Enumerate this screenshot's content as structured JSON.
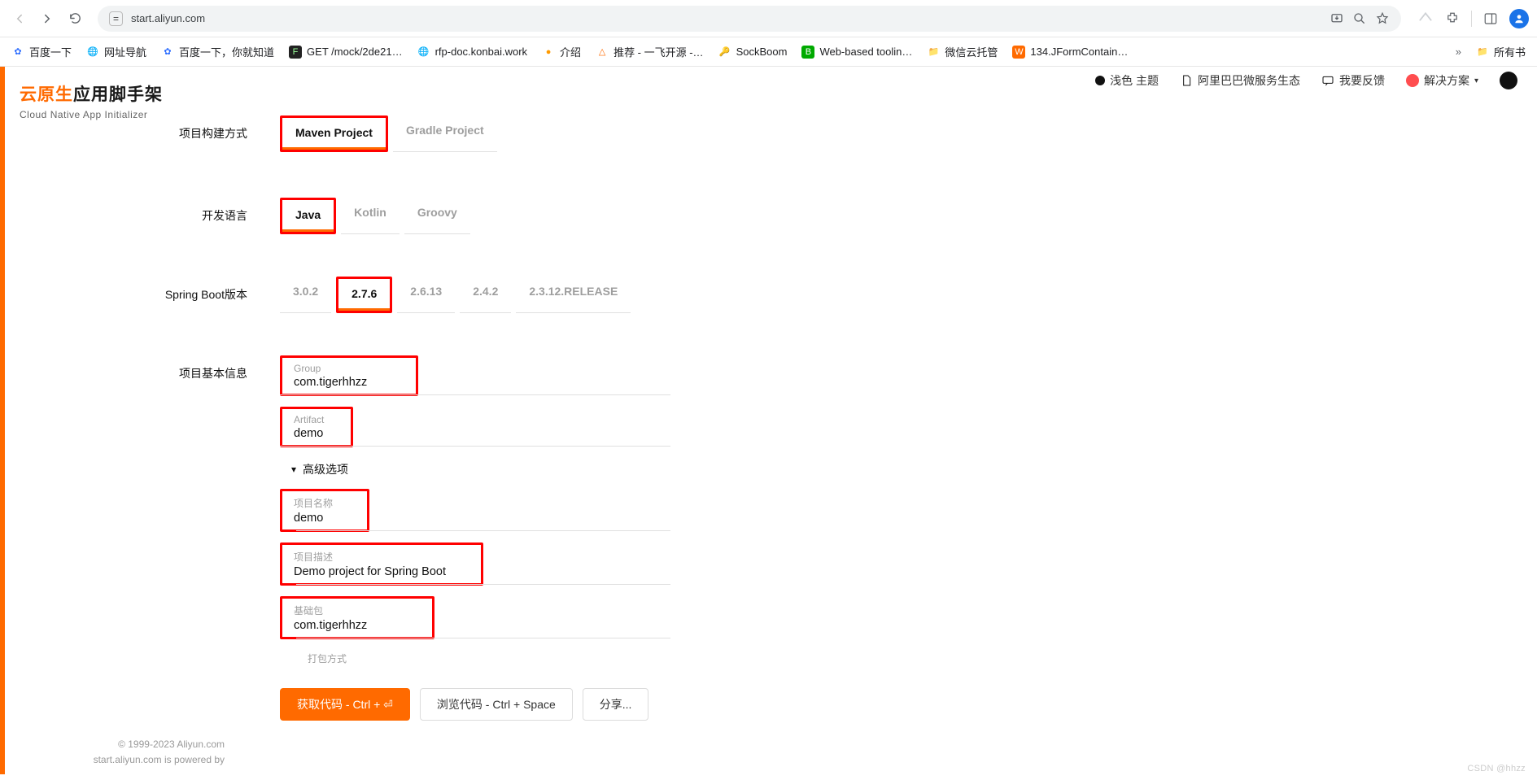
{
  "browser": {
    "url": "start.aliyun.com",
    "bookmarks": [
      {
        "icon": "paw-blue",
        "label": "百度一下"
      },
      {
        "icon": "globe",
        "label": "网址导航"
      },
      {
        "icon": "paw-blue",
        "label": "百度一下，你就知道"
      },
      {
        "icon": "box-dark",
        "label": "GET /mock/2de21…"
      },
      {
        "icon": "globe",
        "label": "rfp-doc.konbai.work"
      },
      {
        "icon": "leaf",
        "label": "介绍"
      },
      {
        "icon": "tri",
        "label": "推荐 - 一飞开源 -…"
      },
      {
        "icon": "key",
        "label": "SockBoom"
      },
      {
        "icon": "b-green",
        "label": "Web-based toolin…"
      },
      {
        "icon": "folder",
        "label": "微信云托管"
      },
      {
        "icon": "box-orange",
        "label": "134.JFormContain…"
      }
    ],
    "more_label": "所有书"
  },
  "header": {
    "brand_accent": "云原生",
    "brand_rest": "应用脚手架",
    "brand_sub": "Cloud Native App Initializer",
    "nav": {
      "theme": "浅色 主题",
      "eco": "阿里巴巴微服务生态",
      "feedback": "我要反馈",
      "solution": "解决方案"
    }
  },
  "form": {
    "build": {
      "label": "项目构建方式",
      "options": [
        "Maven Project",
        "Gradle Project"
      ],
      "active": 0
    },
    "language": {
      "label": "开发语言",
      "options": [
        "Java",
        "Kotlin",
        "Groovy"
      ],
      "active": 0
    },
    "spring": {
      "label": "Spring Boot版本",
      "options": [
        "3.0.2",
        "2.7.6",
        "2.6.13",
        "2.4.2",
        "2.3.12.RELEASE"
      ],
      "active": 1
    },
    "info_label": "项目基本信息",
    "group": {
      "label": "Group",
      "value": "com.tigerhhzz"
    },
    "artifact": {
      "label": "Artifact",
      "value": "demo"
    },
    "adv_label": "高级选项",
    "project_name": {
      "label": "项目名称",
      "value": "demo"
    },
    "project_desc": {
      "label": "项目描述",
      "value": "Demo project for Spring Boot"
    },
    "base_pkg": {
      "label": "基础包",
      "value": "com.tigerhhzz"
    },
    "packaging": {
      "label": "打包方式"
    }
  },
  "buttons": {
    "get_code": "获取代码 - Ctrl + ⏎",
    "browse": "浏览代码 - Ctrl + Space",
    "share": "分享..."
  },
  "footer": {
    "l1": "© 1999-2023 Aliyun.com",
    "l2": "start.aliyun.com is powered by"
  },
  "watermark": "CSDN @hhzz"
}
